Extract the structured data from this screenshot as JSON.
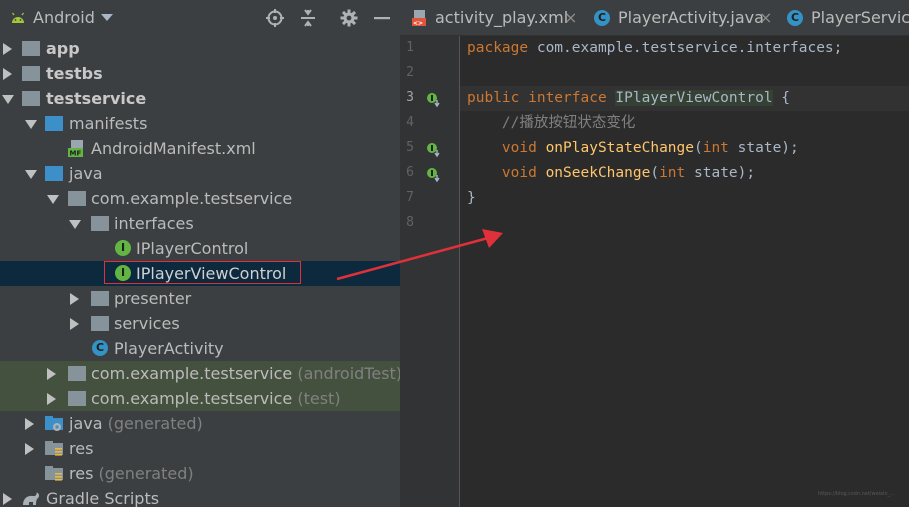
{
  "project_panel": {
    "view_name": "Android",
    "tree": [
      {
        "label": "app",
        "bold": true,
        "icon": "module-folder-icon"
      },
      {
        "label": "testbs",
        "bold": true,
        "icon": "module-folder-icon"
      },
      {
        "label": "testservice",
        "bold": true,
        "icon": "module-folder-icon"
      },
      {
        "label": "manifests",
        "icon": "folder-icon"
      },
      {
        "label": "AndroidManifest.xml",
        "icon": "manifest-file-icon"
      },
      {
        "label": "java",
        "icon": "folder-icon"
      },
      {
        "label": "com.example.testservice",
        "icon": "package-icon"
      },
      {
        "label": "interfaces",
        "icon": "package-icon"
      },
      {
        "label": "IPlayerControl",
        "icon": "interface-icon"
      },
      {
        "label": "IPlayerViewControl",
        "icon": "interface-icon",
        "selected": true
      },
      {
        "label": "presenter",
        "icon": "package-icon"
      },
      {
        "label": "services",
        "icon": "package-icon"
      },
      {
        "label": "PlayerActivity",
        "icon": "class-icon"
      },
      {
        "label": "com.example.testservice",
        "suffix": "(androidTest)",
        "icon": "package-icon"
      },
      {
        "label": "com.example.testservice",
        "suffix": "(test)",
        "icon": "package-icon"
      },
      {
        "label": "java",
        "suffix": "(generated)",
        "icon": "generated-folder-icon"
      },
      {
        "label": "res",
        "icon": "res-folder-icon"
      },
      {
        "label": "res",
        "suffix": "(generated)",
        "icon": "res-folder-icon"
      },
      {
        "label": "Gradle Scripts",
        "icon": "gradle-icon"
      }
    ]
  },
  "editor": {
    "tabs": [
      {
        "label": "activity_play.xml",
        "close": "×",
        "icon": "xml-file-icon"
      },
      {
        "label": "PlayerActivity.java",
        "close": "×",
        "icon": "class-icon"
      },
      {
        "label": "PlayerService",
        "icon": "class-icon"
      }
    ],
    "line_numbers": [
      "1",
      "2",
      "3",
      "4",
      "5",
      "6",
      "7",
      "8"
    ],
    "code": {
      "line1_kw": "package",
      "line1_rest": " com.example.testservice.interfaces;",
      "line3_kw": "public interface",
      "line3_name": "IPlayerViewControl",
      "line3_rest": " {",
      "line4_comment": "//播放按钮状态变化",
      "line5_kw": "void",
      "line5_fn": "onPlayStateChange",
      "line5_open": "(",
      "line5_type": "int",
      "line5_rest": " state);",
      "line6_kw": "void",
      "line6_fn": "onSeekChange",
      "line6_open": "(",
      "line6_type": "int",
      "line6_rest": " state);",
      "line7": "}"
    }
  },
  "colors": {
    "panel_bg": "#3c3f41",
    "editor_bg": "#2b2b2b",
    "selection_bg": "#0d293e",
    "highlight_box": "#e0313a",
    "arrow": "#e0313a",
    "keyword": "#cc7832",
    "function": "#ffc66d",
    "comment": "#808080"
  },
  "watermark": "https://blog.csdn.net/weixin_..."
}
